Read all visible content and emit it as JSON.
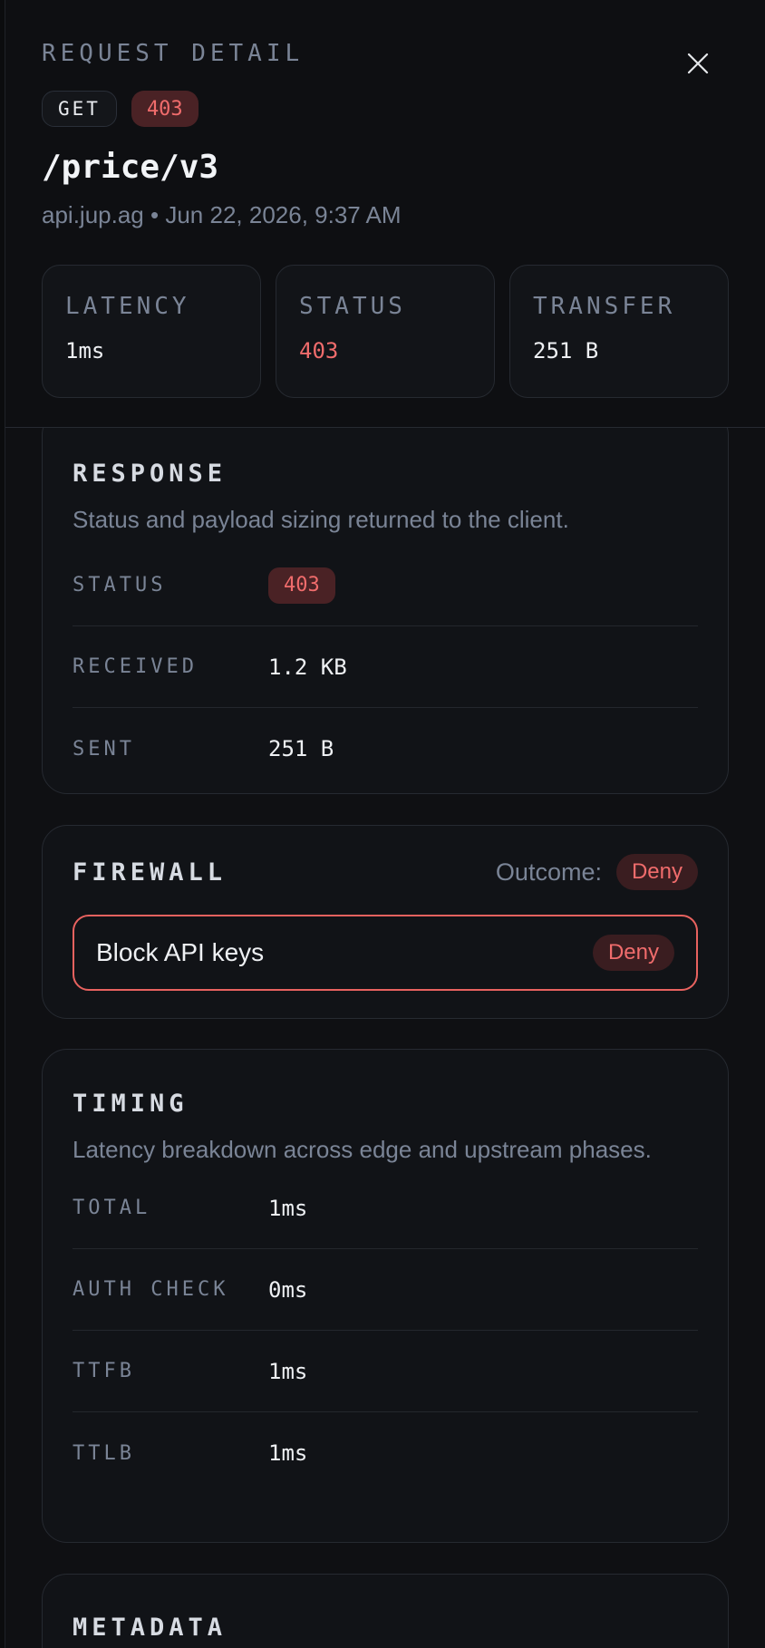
{
  "header": {
    "eyebrow": "REQUEST DETAIL",
    "method": "GET",
    "status": "403",
    "path": "/price/v3",
    "host": "api.jup.ag",
    "separator": "•",
    "timestamp": "Jun 22, 2026, 9:37 AM",
    "stats": [
      {
        "label": "LATENCY",
        "value": "1ms"
      },
      {
        "label": "STATUS",
        "value": "403"
      },
      {
        "label": "TRANSFER",
        "value": "251 B"
      }
    ]
  },
  "response": {
    "title": "RESPONSE",
    "description": "Status and payload sizing returned to the client.",
    "rows": [
      {
        "label": "STATUS",
        "value": "403"
      },
      {
        "label": "RECEIVED",
        "value": "1.2 KB"
      },
      {
        "label": "SENT",
        "value": "251 B"
      }
    ]
  },
  "firewall": {
    "title": "FIREWALL",
    "outcome_label": "Outcome:",
    "outcome_value": "Deny",
    "rule_name": "Block API keys",
    "rule_action": "Deny"
  },
  "timing": {
    "title": "TIMING",
    "description": "Latency breakdown across edge and upstream phases.",
    "rows": [
      {
        "label": "TOTAL",
        "value": "1ms"
      },
      {
        "label": "AUTH CHECK",
        "value": "0ms"
      },
      {
        "label": "TTFB",
        "value": "1ms"
      },
      {
        "label": "TTLB",
        "value": "1ms"
      }
    ]
  },
  "metadata": {
    "title": "METADATA"
  },
  "colors": {
    "background": "#0f1013",
    "danger": "#f06c6c",
    "muted": "#7a8496"
  }
}
